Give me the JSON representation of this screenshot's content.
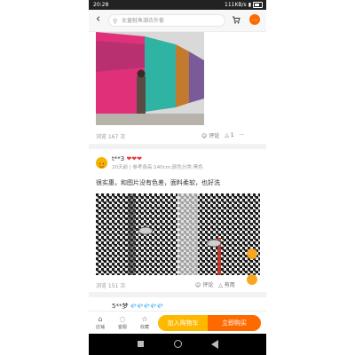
{
  "status": {
    "time": "20:28",
    "network": "111KB/s"
  },
  "search": {
    "placeholder": "女童鲑鱼潮衣外套"
  },
  "review1": {
    "views": "浏览 167 次",
    "comment_label": "评论",
    "like_count": "1"
  },
  "review2": {
    "user": "t**3",
    "hearts": "❤❤❤",
    "meta": "20天前 | 参考身高:140cm;颜色分类:黑色",
    "text": "很实惠，和图片没有色差，面料柔软，也好洗",
    "views": "浏览 151 次",
    "comment_label": "评论",
    "useful_label": "有用"
  },
  "review3": {
    "user": "5**梦",
    "diamonds": "💎💎💎💎💎"
  },
  "bottom": {
    "shop": "店铺",
    "service": "客服",
    "favorite": "收藏",
    "add_cart": "加入购物车",
    "buy_now": "立即购买"
  },
  "colors": {
    "accent": "#ff6a00",
    "cart": "#ffb800"
  }
}
